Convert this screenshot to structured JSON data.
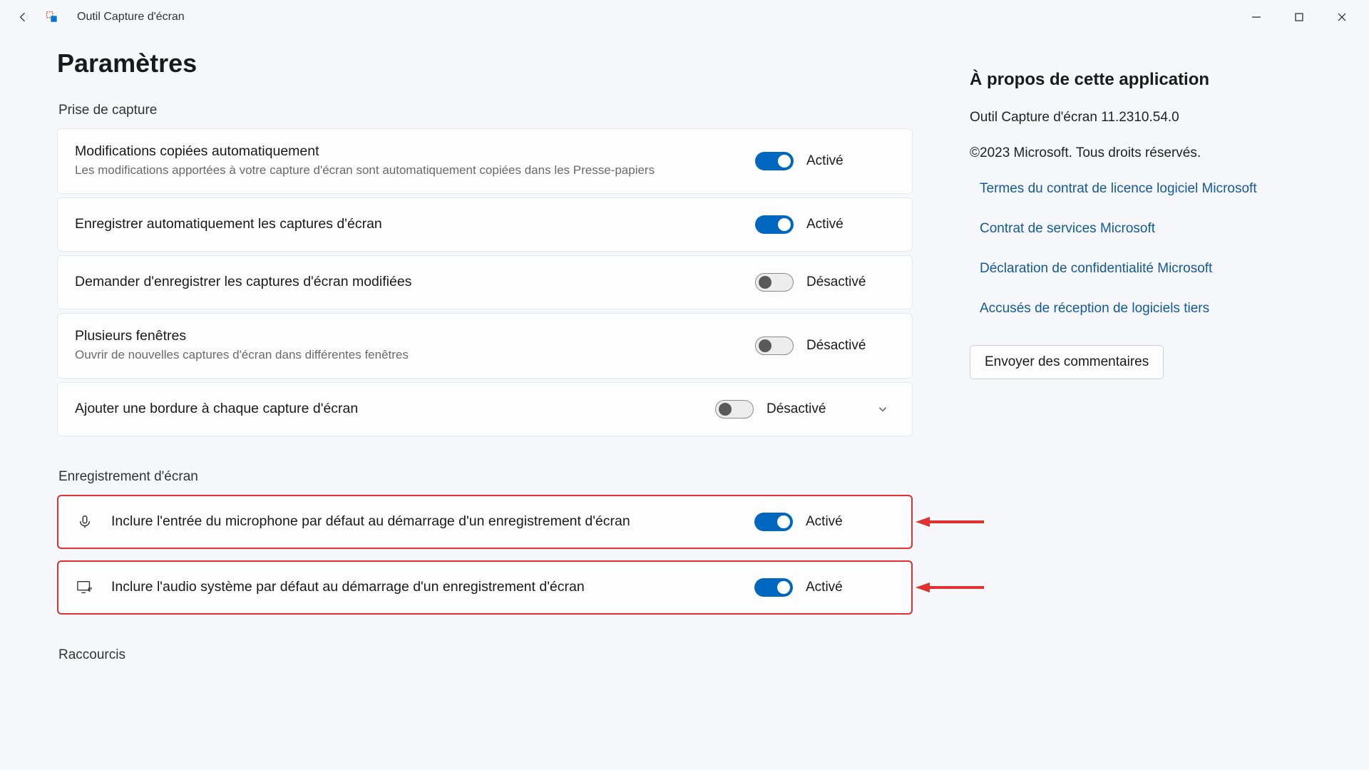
{
  "window": {
    "title": "Outil Capture d'écran"
  },
  "page": {
    "heading": "Paramètres"
  },
  "sections": {
    "capture": {
      "label": "Prise de capture"
    },
    "recording": {
      "label": "Enregistrement d'écran"
    },
    "shortcuts": {
      "label": "Raccourcis"
    }
  },
  "toggle_labels": {
    "on": "Activé",
    "off": "Désactivé"
  },
  "settings": {
    "auto_copy": {
      "title": "Modifications copiées automatiquement",
      "sub": "Les modifications apportées à votre capture d'écran sont automatiquement copiées dans les Presse-papiers",
      "state": "on"
    },
    "auto_save": {
      "title": "Enregistrer automatiquement les captures d'écran",
      "state": "on"
    },
    "ask_save_edited": {
      "title": "Demander d'enregistrer les captures d'écran modifiées",
      "state": "off"
    },
    "multi_window": {
      "title": "Plusieurs fenêtres",
      "sub": "Ouvrir de nouvelles captures d'écran dans différentes fenêtres",
      "state": "off"
    },
    "add_border": {
      "title": "Ajouter une bordure à chaque capture d'écran",
      "state": "off",
      "expandable": true
    },
    "mic_default": {
      "title": "Inclure l'entrée du microphone par défaut au démarrage d'un enregistrement d'écran",
      "state": "on"
    },
    "sysaudio_default": {
      "title": "Inclure l'audio système par défaut au démarrage d'un enregistrement d'écran",
      "state": "on"
    }
  },
  "about": {
    "heading": "À propos de cette application",
    "version_line": "Outil Capture d'écran 11.2310.54.0",
    "copyright": "©2023 Microsoft. Tous droits réservés.",
    "links": [
      "Termes du contrat de licence logiciel Microsoft",
      "Contrat de services Microsoft",
      "Déclaration de confidentialité Microsoft",
      "Accusés de réception de logiciels tiers"
    ],
    "feedback_btn": "Envoyer des commentaires"
  }
}
